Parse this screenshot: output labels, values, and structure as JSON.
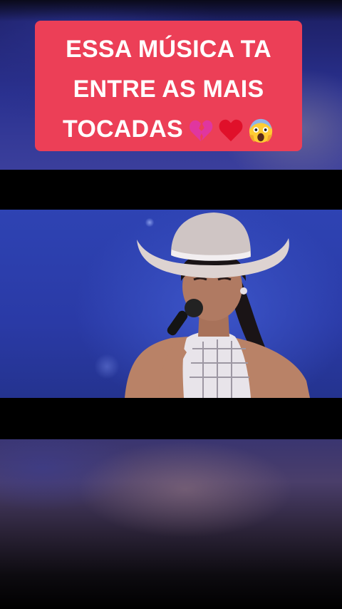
{
  "caption": {
    "line1": "ESSA MÚSICA TA",
    "line2": "ENTRE AS MAIS",
    "line3": "TOCADAS",
    "emojis": [
      "broken-heart-emoji",
      "red-heart-emoji",
      "screaming-face-emoji"
    ]
  },
  "colors": {
    "caption_bg": "#ec3f57",
    "caption_text": "#ffffff",
    "stage_blue": "#2e43b3"
  }
}
